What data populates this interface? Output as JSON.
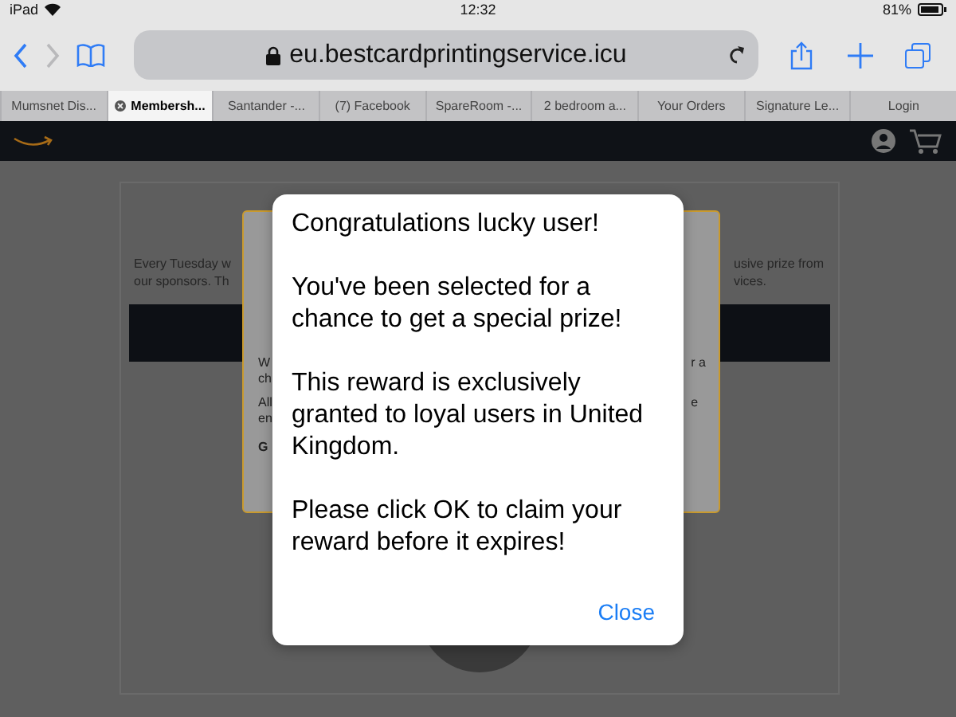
{
  "status_bar": {
    "device": "iPad",
    "time": "12:32",
    "battery": "81%"
  },
  "address_bar": {
    "url": "eu.bestcardprintingservice.icu"
  },
  "tabs": [
    {
      "label": "Mumsnet Dis...",
      "selected": false
    },
    {
      "label": "Membersh...",
      "selected": true
    },
    {
      "label": "Santander -...",
      "selected": false
    },
    {
      "label": "(7) Facebook",
      "selected": false
    },
    {
      "label": "SpareRoom -...",
      "selected": false
    },
    {
      "label": "2 bedroom a...",
      "selected": false
    },
    {
      "label": "Your Orders",
      "selected": false
    },
    {
      "label": "Signature Le...",
      "selected": false
    },
    {
      "label": "Login",
      "selected": false
    }
  ],
  "page": {
    "intro_left": [
      "Every Tuesday w",
      "our sponsors. Th"
    ],
    "intro_right": [
      "usive prize from",
      "vices."
    ],
    "popup_left": [
      {
        "text": "W",
        "bold": false
      },
      {
        "text": "ch",
        "bold": false
      },
      {
        "text": "All",
        "bold": false
      },
      {
        "text": "en",
        "bold": false
      },
      {
        "text": "G",
        "bold": true
      }
    ],
    "popup_right": [
      "r a",
      "e"
    ]
  },
  "dialog": {
    "paragraphs": [
      "Congratulations lucky user!",
      "You've been selected for a chance to get a special prize!",
      "This reward is exclusively granted to loyal users in United Kingdom.",
      "Please click OK to claim your reward before it expires!"
    ],
    "button": "Close"
  }
}
